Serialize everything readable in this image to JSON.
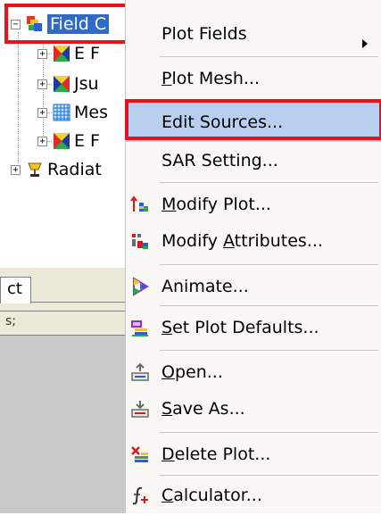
{
  "tree": {
    "root": {
      "label": "Field C",
      "expander": "−",
      "icon": "field-results-icon"
    },
    "children": [
      {
        "label": "E F",
        "icon": "e-field-plot-icon",
        "expander": "+"
      },
      {
        "label": "Jsu",
        "icon": "surface-current-plot-icon",
        "expander": "+"
      },
      {
        "label": "Mes",
        "icon": "mesh-grid-icon",
        "expander": "+"
      },
      {
        "label": "E F",
        "icon": "e-field-plot-icon",
        "expander": "+"
      }
    ],
    "radiation": {
      "label": "Radiat",
      "icon": "radiation-trophy-icon",
      "expander": "+"
    }
  },
  "tab": {
    "label": "ct"
  },
  "panel_2": {
    "label": "s;"
  },
  "menu": {
    "items": [
      {
        "id": "plot-fields",
        "label": "Plot Fields",
        "has_submenu": true
      },
      {
        "id": "plot-mesh",
        "label_pre": "",
        "label_ul": "P",
        "label_post": "lot Mesh..."
      },
      {
        "id": "edit-sources",
        "label": "Edit Sources..."
      },
      {
        "id": "sar-setting",
        "label": "SAR Setting..."
      },
      {
        "id": "modify-plot",
        "label_pre": "",
        "label_ul": "M",
        "label_post": "odify Plot...",
        "icon": "modify-plot-icon"
      },
      {
        "id": "modify-attributes",
        "label_pre": "Modify ",
        "label_ul": "A",
        "label_post": "ttributes...",
        "icon": "modify-attributes-icon"
      },
      {
        "id": "animate",
        "label": "Animate...",
        "icon": "animate-icon"
      },
      {
        "id": "set-plot-defaults",
        "label_pre": "",
        "label_ul": "S",
        "label_post": "et Plot Defaults...",
        "icon": "set-plot-defaults-icon"
      },
      {
        "id": "open",
        "label_pre": "",
        "label_ul": "O",
        "label_post": "pen...",
        "icon": "open-icon"
      },
      {
        "id": "save-as",
        "label_pre": "",
        "label_ul": "S",
        "label_post": "ave As...",
        "icon": "save-as-icon"
      },
      {
        "id": "delete-plot",
        "label_pre": "",
        "label_ul": "D",
        "label_post": "elete Plot...",
        "icon": "delete-plot-icon"
      },
      {
        "id": "calculator",
        "label_pre": "",
        "label_ul": "C",
        "label_post": "alculator...",
        "icon": "calculator-icon"
      }
    ]
  },
  "colors": {
    "selection_blue": "#316ac5",
    "menu_hover": "#b8cff0",
    "highlight_red": "#e8121b"
  }
}
